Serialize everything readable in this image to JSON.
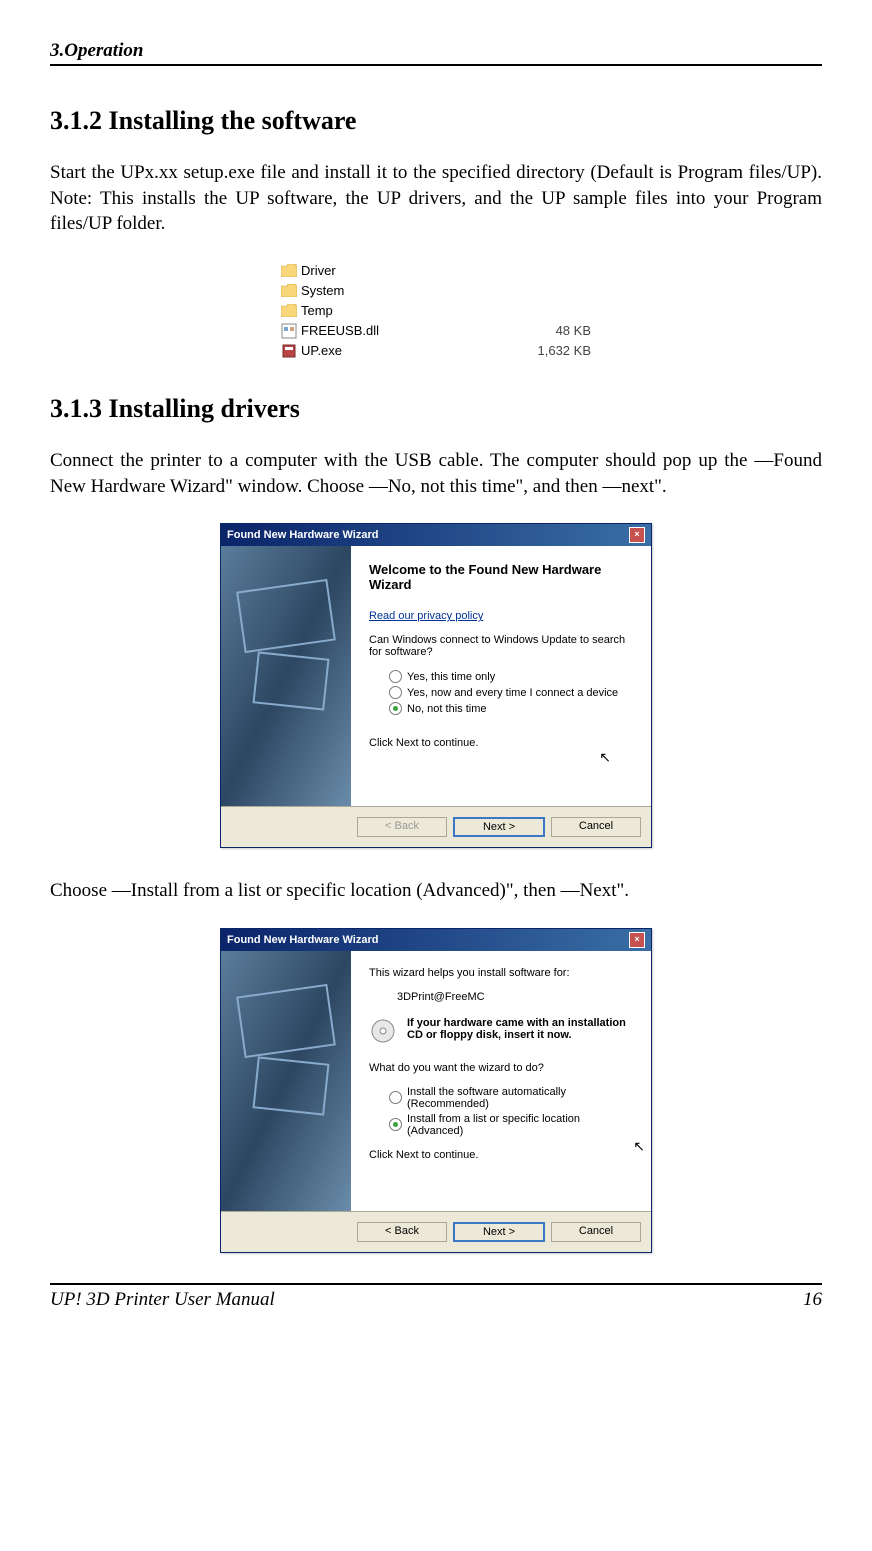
{
  "header": {
    "section": "3.Operation"
  },
  "section312": {
    "heading": "3.1.2 Installing the software",
    "body": "Start the UPx.xx setup.exe file and install it to the specified directory (Default is Program files/UP). Note: This installs the UP software, the UP drivers, and the UP sample files into your Program files/UP folder."
  },
  "fileList": {
    "rows": [
      {
        "name": "Driver",
        "type": "folder",
        "size": ""
      },
      {
        "name": "System",
        "type": "folder",
        "size": ""
      },
      {
        "name": "Temp",
        "type": "folder",
        "size": ""
      },
      {
        "name": "FREEUSB.dll",
        "type": "dll",
        "size": "48 KB"
      },
      {
        "name": "UP.exe",
        "type": "exe",
        "size": "1,632 KB"
      }
    ]
  },
  "section313": {
    "heading": "3.1.3 Installing drivers",
    "body": "Connect the printer to a computer with the USB cable. The computer should pop up the ―Found New Hardware Wizard\" window. Choose ―No, not this time\", and then ―next\"."
  },
  "wizard1": {
    "title": "Found New Hardware Wizard",
    "welcome": "Welcome to the Found New Hardware Wizard",
    "privacy": "Read our privacy policy",
    "question": "Can Windows connect to Windows Update to search for software?",
    "options": {
      "opt1": "Yes, this time only",
      "opt2": "Yes, now and every time I connect a device",
      "opt3": "No, not this time"
    },
    "continue": "Click Next to continue.",
    "buttons": {
      "back": "< Back",
      "next": "Next >",
      "cancel": "Cancel"
    }
  },
  "midtext": "Choose ―Install from a list or specific location (Advanced)\", then ―Next\".",
  "wizard2": {
    "title": "Found New Hardware Wizard",
    "helptext": "This wizard helps you install software for:",
    "device": "3DPrint@FreeMC",
    "cdtext": "If your hardware came with an installation CD or floppy disk, insert it now.",
    "question": "What do you want the wizard to do?",
    "options": {
      "opt1": "Install the software automatically (Recommended)",
      "opt2": "Install from a list or specific location (Advanced)"
    },
    "continue": "Click Next to continue.",
    "buttons": {
      "back": "< Back",
      "next": "Next >",
      "cancel": "Cancel"
    }
  },
  "footer": {
    "title": "UP! 3D Printer User Manual",
    "page": "16"
  }
}
